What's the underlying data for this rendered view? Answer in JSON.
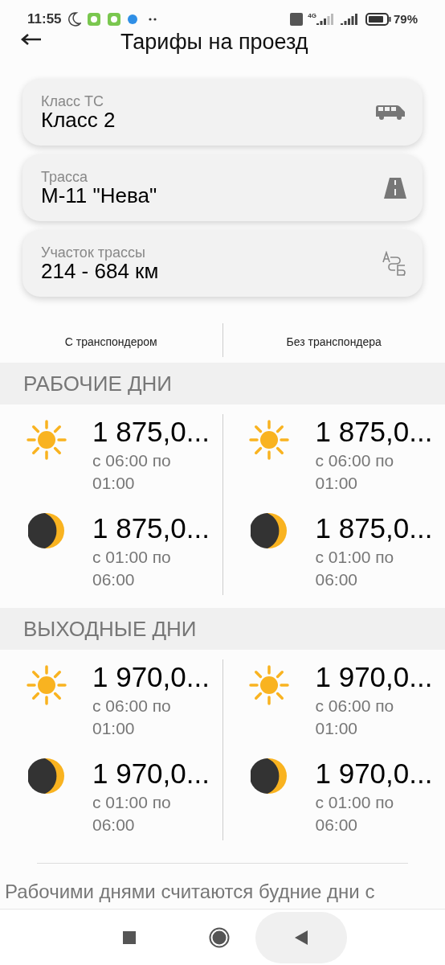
{
  "status_bar": {
    "time": "11:55",
    "network": "4G",
    "battery": "79%"
  },
  "header": {
    "title": "Тарифы на проезд"
  },
  "fields": [
    {
      "label": "Класс ТС",
      "value": "Класс 2",
      "kind": "vehicle"
    },
    {
      "label": "Трасса",
      "value": "М-11 \"Нева\"",
      "kind": "road"
    },
    {
      "label": "Участок трассы",
      "value": "214 - 684 км",
      "kind": "route"
    }
  ],
  "tabs": [
    {
      "label": "С транспондером"
    },
    {
      "label": "Без транспондера"
    }
  ],
  "sections": [
    {
      "title": "РАБОЧИЕ ДНИ",
      "columns": [
        [
          {
            "kind": "day",
            "price": "1 875,0...",
            "time": "с 06:00 по 01:00"
          },
          {
            "kind": "night",
            "price": "1 875,0...",
            "time": "с 01:00 по 06:00"
          }
        ],
        [
          {
            "kind": "day",
            "price": "1 875,0...",
            "time": "с 06:00 по 01:00"
          },
          {
            "kind": "night",
            "price": "1 875,0...",
            "time": "с 01:00 по 06:00"
          }
        ]
      ]
    },
    {
      "title": "ВЫХОДНЫЕ ДНИ",
      "columns": [
        [
          {
            "kind": "day",
            "price": "1 970,0...",
            "time": "с 06:00 по 01:00"
          },
          {
            "kind": "night",
            "price": "1 970,0...",
            "time": "с 01:00 по 06:00"
          }
        ],
        [
          {
            "kind": "day",
            "price": "1 970,0...",
            "time": "с 06:00 по 01:00"
          },
          {
            "kind": "night",
            "price": "1 970,0...",
            "time": "с 01:00 по 06:00"
          }
        ]
      ]
    }
  ],
  "footer_note": "Рабочими днями считаются будние дни с"
}
